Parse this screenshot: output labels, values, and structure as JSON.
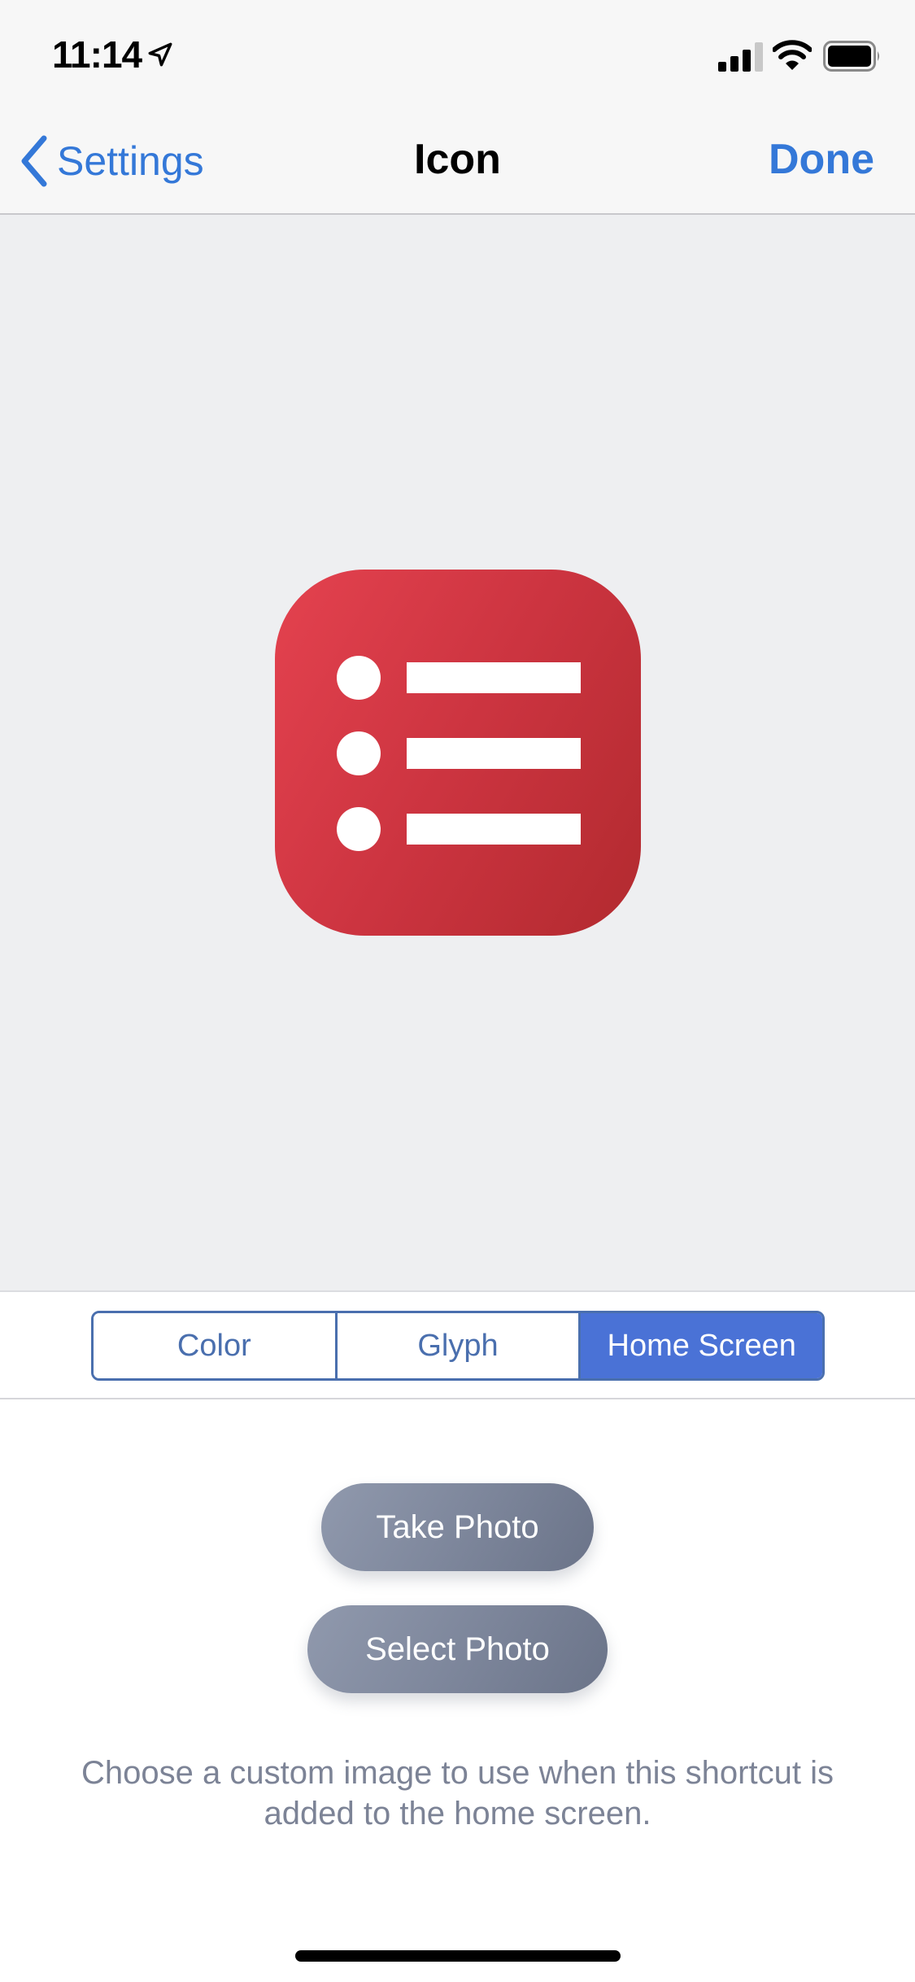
{
  "status_bar": {
    "time": "11:14",
    "location_icon": "location-arrow-icon",
    "signal_icon": "cellular-signal-icon",
    "signal_bars": 3,
    "signal_bars_max": 4,
    "wifi_icon": "wifi-icon",
    "battery_icon": "battery-icon",
    "battery_level": 1.0
  },
  "nav": {
    "back_icon": "chevron-left-icon",
    "back_label": "Settings",
    "title": "Icon",
    "done_label": "Done"
  },
  "preview": {
    "icon_glyph": "list-bullets-icon",
    "icon_color_start": "#e4424f",
    "icon_color_end": "#b22a2f"
  },
  "segmented": {
    "selected_index": 2,
    "options": [
      {
        "label": "Color"
      },
      {
        "label": "Glyph"
      },
      {
        "label": "Home Screen"
      }
    ]
  },
  "actions": {
    "take_photo": "Take Photo",
    "select_photo": "Select Photo"
  },
  "caption": "Choose a custom image to use when this shortcut is added to the home screen.",
  "colors": {
    "accent": "#3478d8",
    "segment_active": "#4a72d6",
    "segment_border": "#4a6fae",
    "pill_button": "#7e879c",
    "caption_text": "#7c8396"
  }
}
